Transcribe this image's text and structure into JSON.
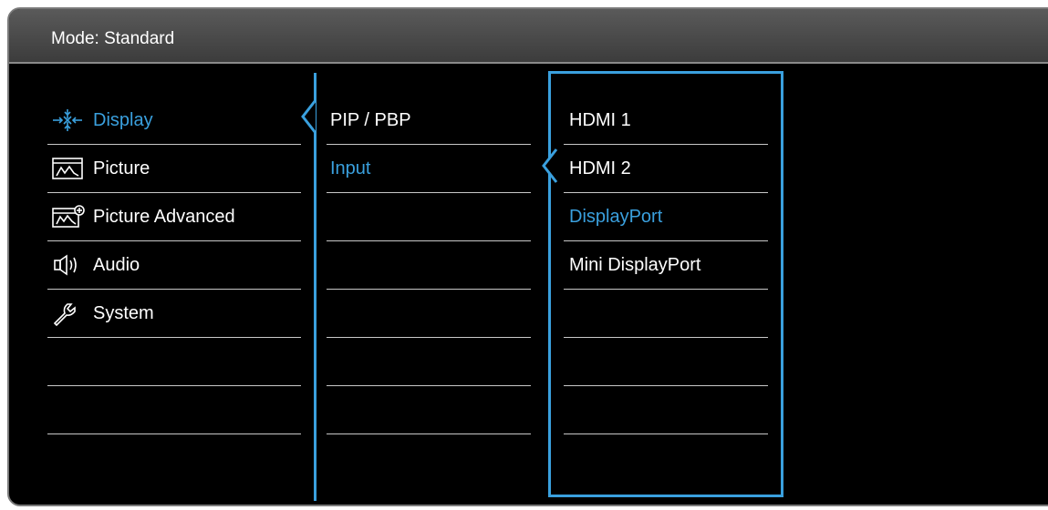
{
  "header": {
    "mode_label": "Mode: Standard"
  },
  "main_menu": {
    "items": [
      {
        "label": "Display",
        "icon": "display-icon",
        "active": true
      },
      {
        "label": "Picture",
        "icon": "picture-icon",
        "active": false
      },
      {
        "label": "Picture Advanced",
        "icon": "picture-advanced-icon",
        "active": false
      },
      {
        "label": "Audio",
        "icon": "audio-icon",
        "active": false
      },
      {
        "label": "System",
        "icon": "wrench-icon",
        "active": false
      },
      {
        "label": ""
      },
      {
        "label": ""
      }
    ]
  },
  "sub_menu": {
    "items": [
      {
        "label": "PIP / PBP",
        "active": false
      },
      {
        "label": "Input",
        "active": true
      },
      {
        "label": ""
      },
      {
        "label": ""
      },
      {
        "label": ""
      },
      {
        "label": ""
      },
      {
        "label": ""
      }
    ]
  },
  "options": {
    "items": [
      {
        "label": "HDMI 1",
        "active": false
      },
      {
        "label": "HDMI 2",
        "active": false
      },
      {
        "label": "DisplayPort",
        "active": true
      },
      {
        "label": "Mini DisplayPort",
        "active": false
      },
      {
        "label": ""
      },
      {
        "label": ""
      },
      {
        "label": ""
      }
    ]
  },
  "colors": {
    "accent": "#3aa0de",
    "text": "#ffffff",
    "background": "#000000",
    "header": "#4a4a4a"
  }
}
